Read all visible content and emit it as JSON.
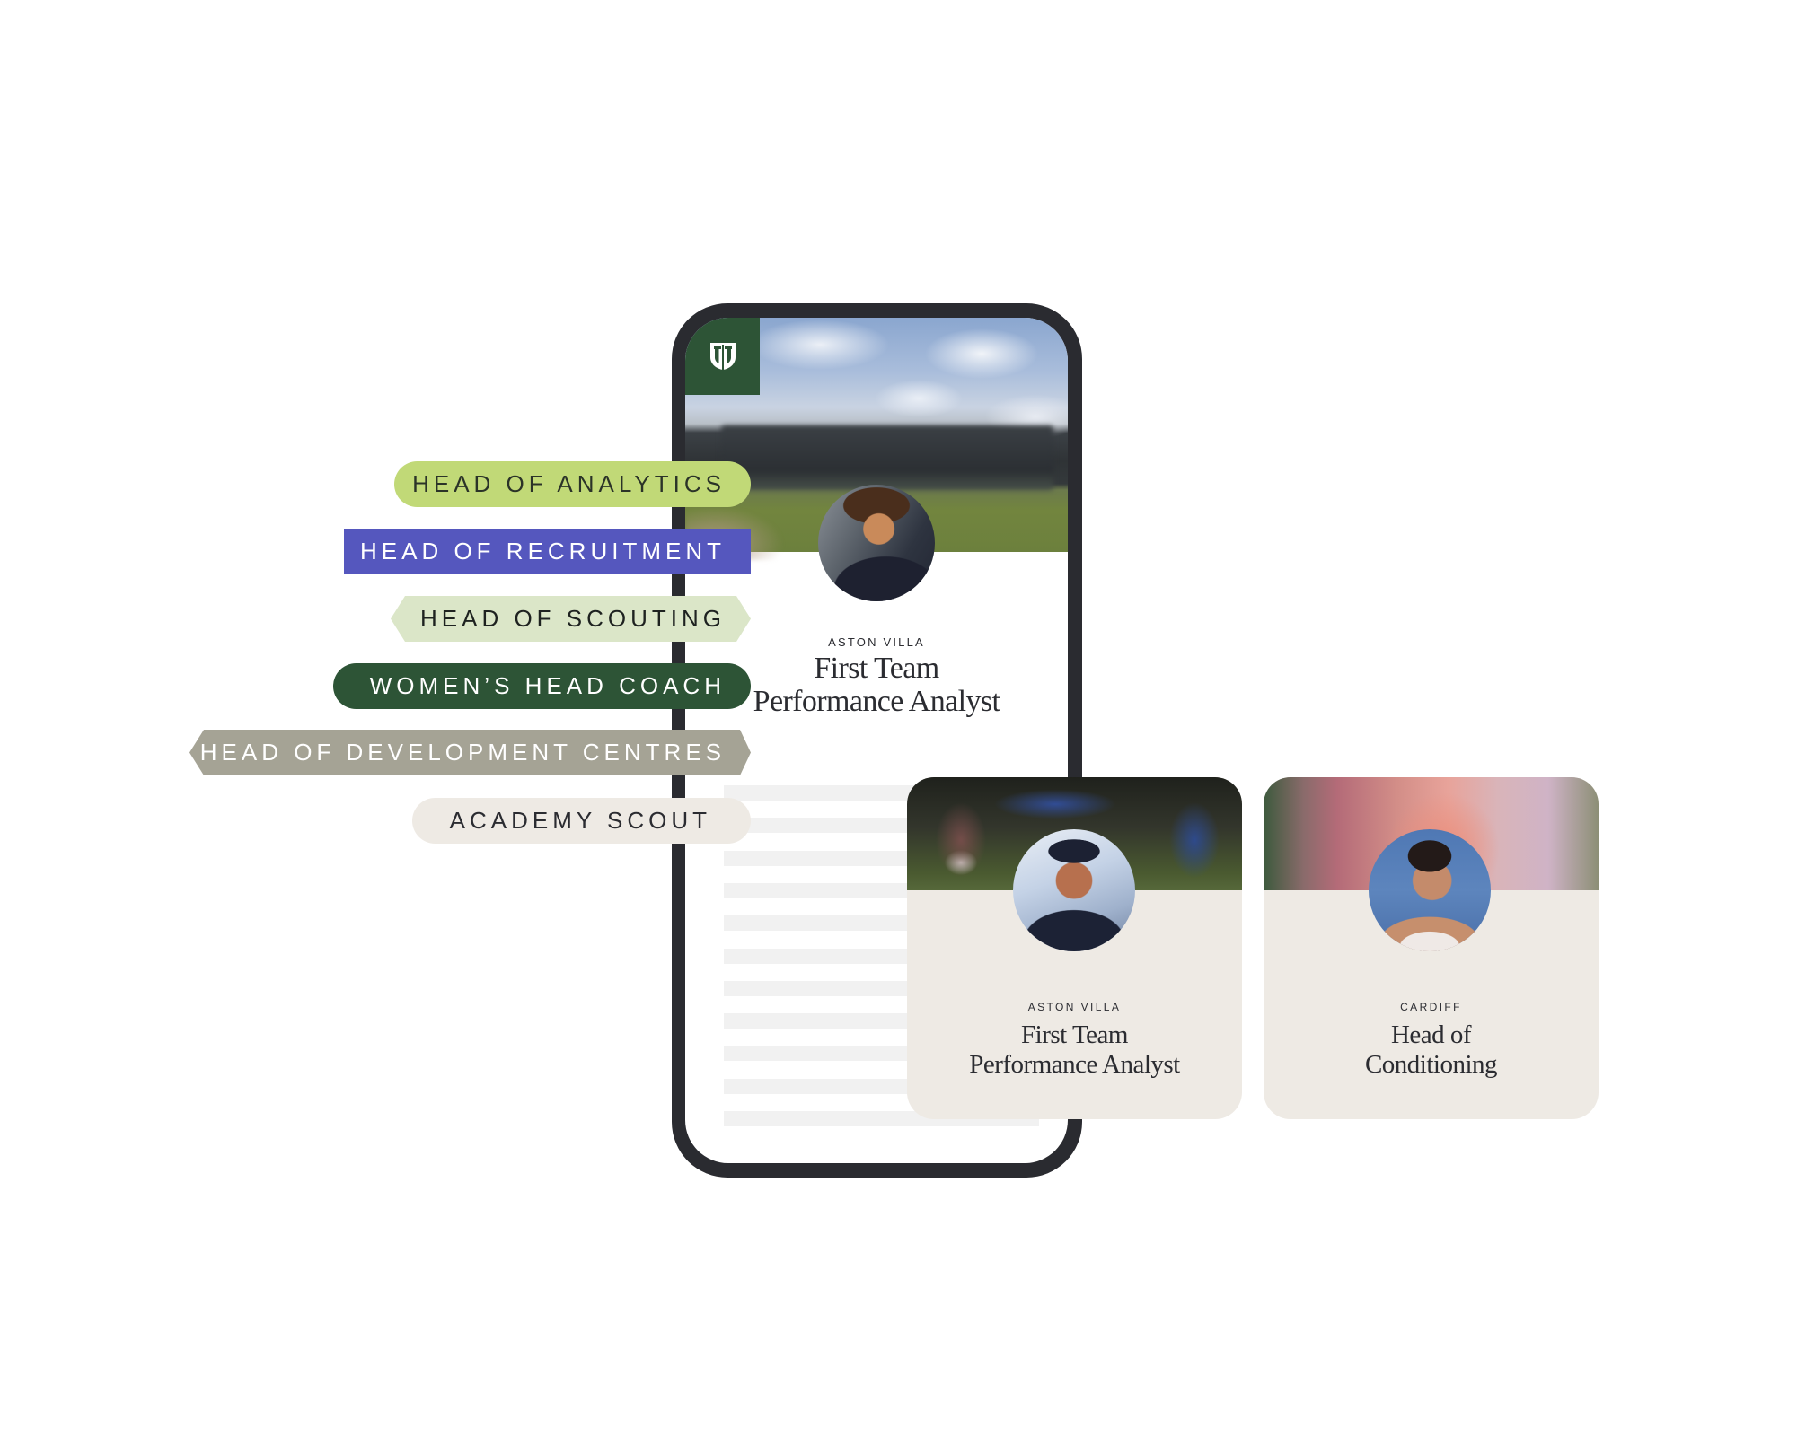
{
  "brand": {
    "logo_icon": "shield-monogram-icon",
    "colors": {
      "brand_green": "#2d5436",
      "phone_frame": "#2a2b30",
      "card_bg": "#eeeae4",
      "text": "#2b2c31"
    }
  },
  "phone": {
    "featured_job": {
      "club": "ASTON VILLA",
      "title_line1": "First Team",
      "title_line2": "Performance Analyst",
      "avatar": "person-photo-curly-hair"
    },
    "placeholder_line_count": 11
  },
  "job_tags": [
    {
      "label": "HEAD OF ANALYTICS",
      "color": "#c1d977"
    },
    {
      "label": "HEAD OF RECRUITMENT",
      "color": "#5557be"
    },
    {
      "label": "HEAD OF SCOUTING",
      "color": "#dbe6c8"
    },
    {
      "label": "WOMEN’S HEAD COACH",
      "color": "#2d5436"
    },
    {
      "label": "HEAD OF DEVELOPMENT CENTRES",
      "color": "#a5a395"
    },
    {
      "label": "ACADEMY SCOUT",
      "color": "#eeeae4"
    }
  ],
  "cards": [
    {
      "club": "ASTON VILLA",
      "title_line1": "First Team",
      "title_line2": "Performance Analyst",
      "avatar": "person-photo-cap"
    },
    {
      "club": "CARDIFF",
      "title_line1": "Head of",
      "title_line2": "Conditioning",
      "avatar": "person-photo-braids"
    }
  ]
}
